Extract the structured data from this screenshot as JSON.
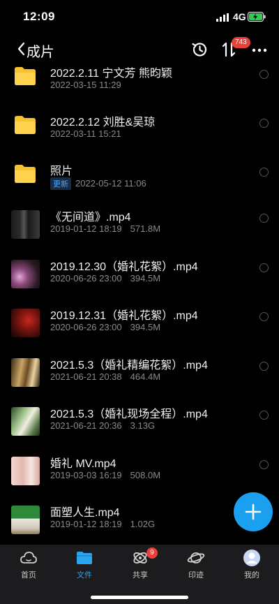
{
  "status_bar": {
    "time": "12:09",
    "network": "4G"
  },
  "nav": {
    "back_label": "成片",
    "sort_badge": "743"
  },
  "colors": {
    "accent": "#1aa0ee",
    "badge": "#e8413b",
    "folder": "#f6c232",
    "tag": "#4aa3ff"
  },
  "files": [
    {
      "kind": "folder",
      "name": "2022.2.11 宁文芳 熊昀颖",
      "date": "2022-03-15 11:29",
      "size": "",
      "tag": ""
    },
    {
      "kind": "folder",
      "name": "2022.2.12 刘胜&吴琼",
      "date": "2022-03-11 15:21",
      "size": "",
      "tag": ""
    },
    {
      "kind": "folder",
      "name": "照片",
      "date": "2022-05-12 11:06",
      "size": "",
      "tag": "更新"
    },
    {
      "kind": "video",
      "name": "《无间道》.mp4",
      "date": "2019-01-12 18:19",
      "size": "571.8M",
      "tag": ""
    },
    {
      "kind": "video",
      "name": "2019.12.30（婚礼花絮）.mp4",
      "date": "2020-06-26 23:00",
      "size": "394.5M",
      "tag": ""
    },
    {
      "kind": "video",
      "name": "2019.12.31（婚礼花絮）.mp4",
      "date": "2020-06-26 23:00",
      "size": "394.5M",
      "tag": ""
    },
    {
      "kind": "video",
      "name": "2021.5.3（婚礼精编花絮）.mp4",
      "date": "2021-06-21 20:38",
      "size": "464.4M",
      "tag": ""
    },
    {
      "kind": "video",
      "name": "2021.5.3（婚礼现场全程）.mp4",
      "date": "2021-06-21 20:36",
      "size": "3.13G",
      "tag": ""
    },
    {
      "kind": "video",
      "name": "婚礼 MV.mp4",
      "date": "2019-03-03 16:19",
      "size": "508.0M",
      "tag": ""
    },
    {
      "kind": "video",
      "name": "面塑人生.mp4",
      "date": "2019-01-12 18:19",
      "size": "1.02G",
      "tag": ""
    }
  ],
  "tabbar": {
    "home": "首页",
    "files": "文件",
    "share": "共享",
    "share_badge": "9",
    "footprint": "印迹",
    "mine": "我的"
  }
}
